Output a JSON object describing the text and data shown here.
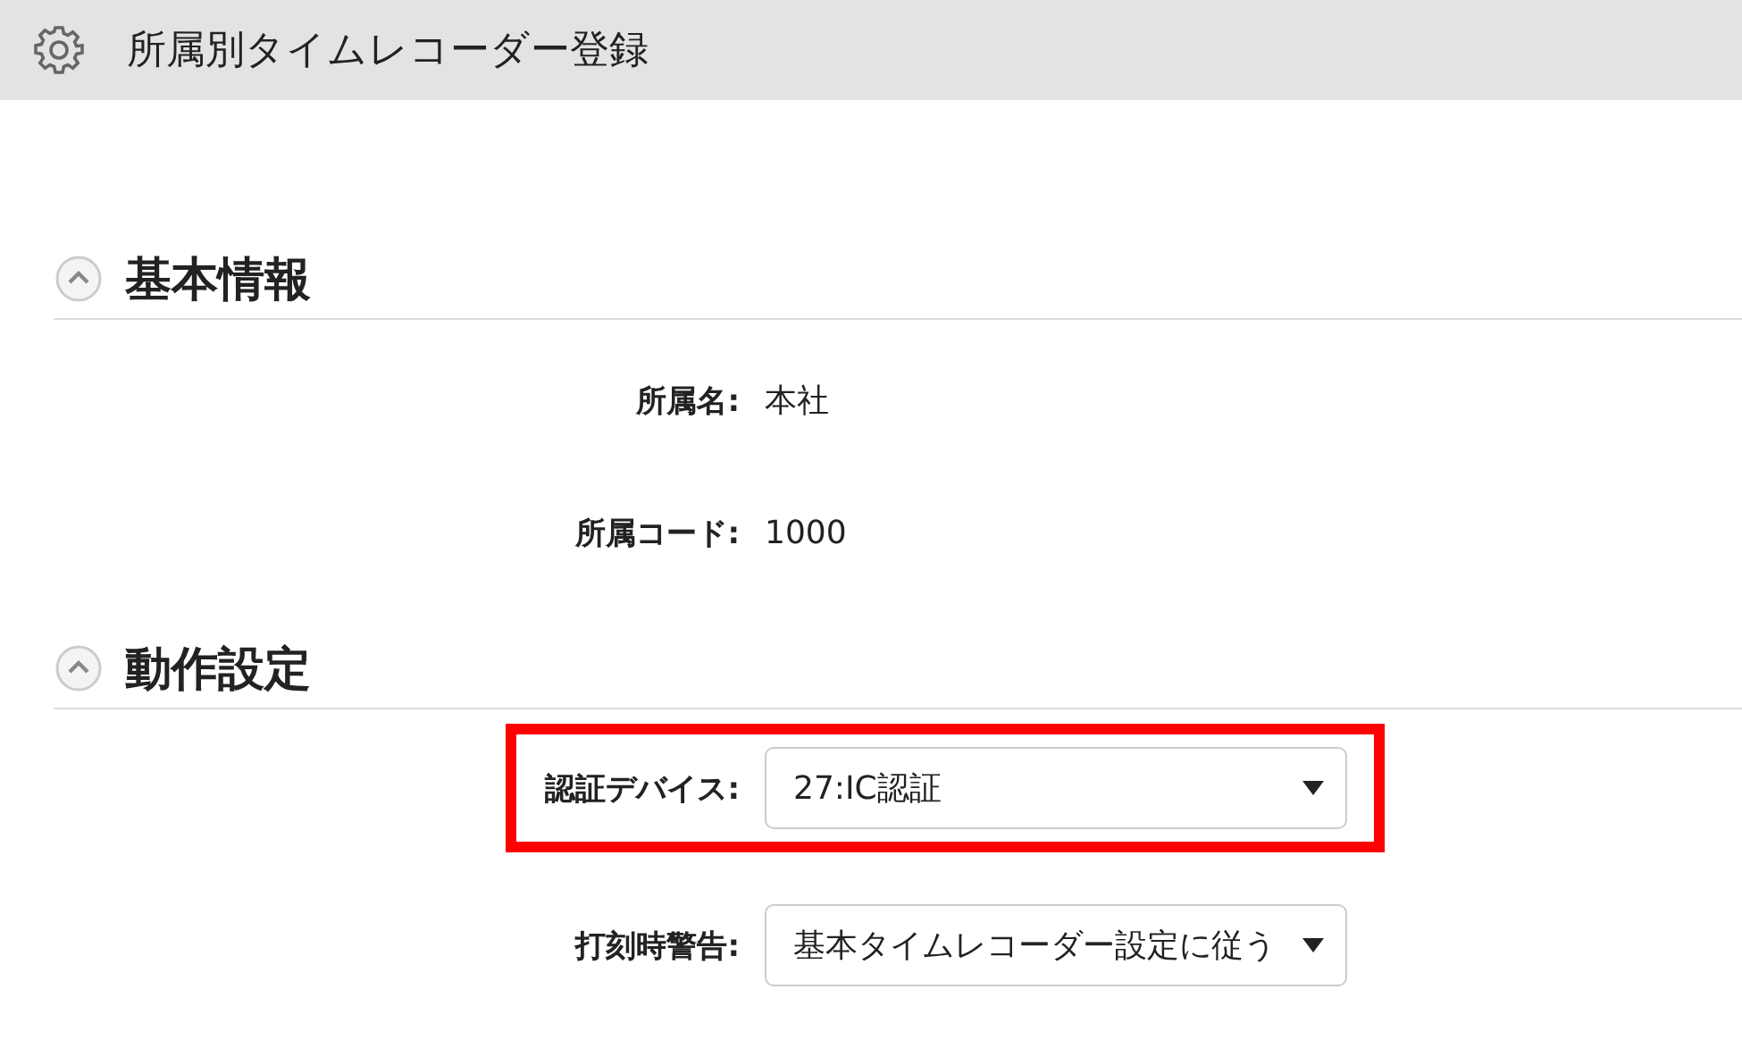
{
  "header": {
    "title": "所属別タイムレコーダー登録"
  },
  "sections": [
    {
      "title": "基本情報",
      "expanded": true,
      "fields": [
        {
          "kind": "text",
          "label": "所属名:",
          "value": "本社",
          "highlighted": false
        },
        {
          "kind": "text",
          "label": "所属コード:",
          "value": "1000",
          "highlighted": false
        }
      ]
    },
    {
      "title": "動作設定",
      "expanded": true,
      "fields": [
        {
          "kind": "select",
          "label": "認証デバイス:",
          "value": "27:IC認証",
          "highlighted": true
        },
        {
          "kind": "select",
          "label": "打刻時警告:",
          "value": "基本タイムレコーダー設定に従う",
          "highlighted": false
        }
      ]
    }
  ]
}
